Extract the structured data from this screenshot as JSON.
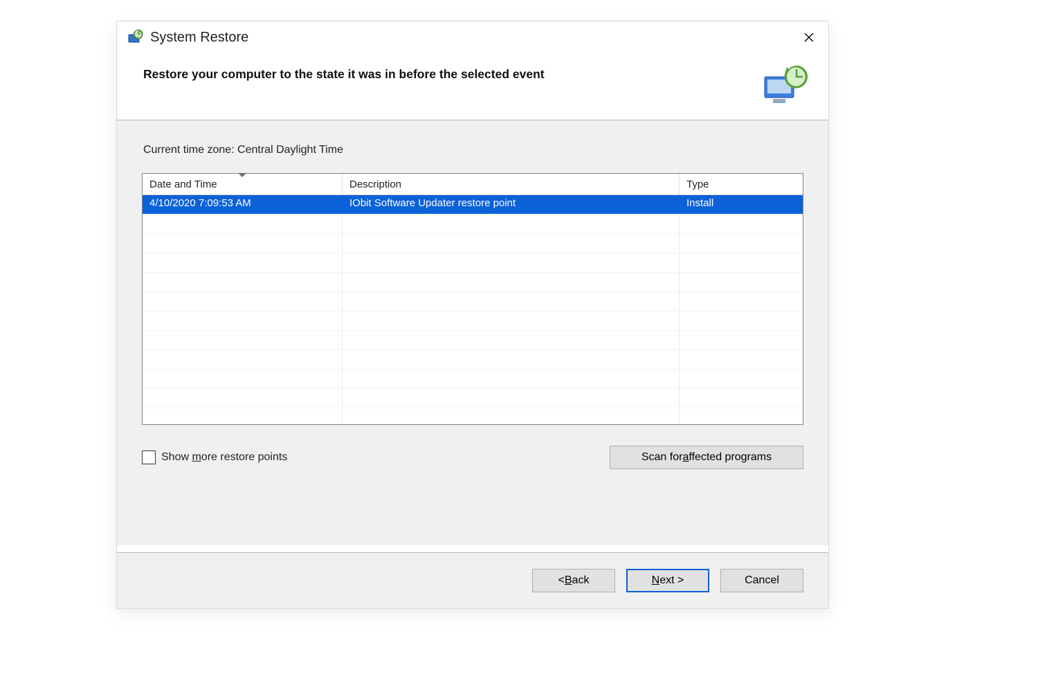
{
  "window": {
    "title": "System Restore"
  },
  "header": {
    "headline": "Restore your computer to the state it was in before the selected event"
  },
  "body": {
    "timezone_label": "Current time zone: Central Daylight Time",
    "columns": {
      "datetime": "Date and Time",
      "description": "Description",
      "type": "Type"
    },
    "rows": [
      {
        "datetime": "4/10/2020 7:09:53 AM",
        "description": "IObit Software Updater restore point",
        "type": "Install",
        "selected": true
      }
    ],
    "checkbox_label_pre": "Show ",
    "checkbox_label_hot": "m",
    "checkbox_label_post": "ore restore points",
    "scan_label_pre": "Scan for ",
    "scan_label_hot": "a",
    "scan_label_post": "ffected programs"
  },
  "footer": {
    "back_pre": "< ",
    "back_hot": "B",
    "back_post": "ack",
    "next_hot": "N",
    "next_post": "ext >",
    "cancel": "Cancel"
  }
}
